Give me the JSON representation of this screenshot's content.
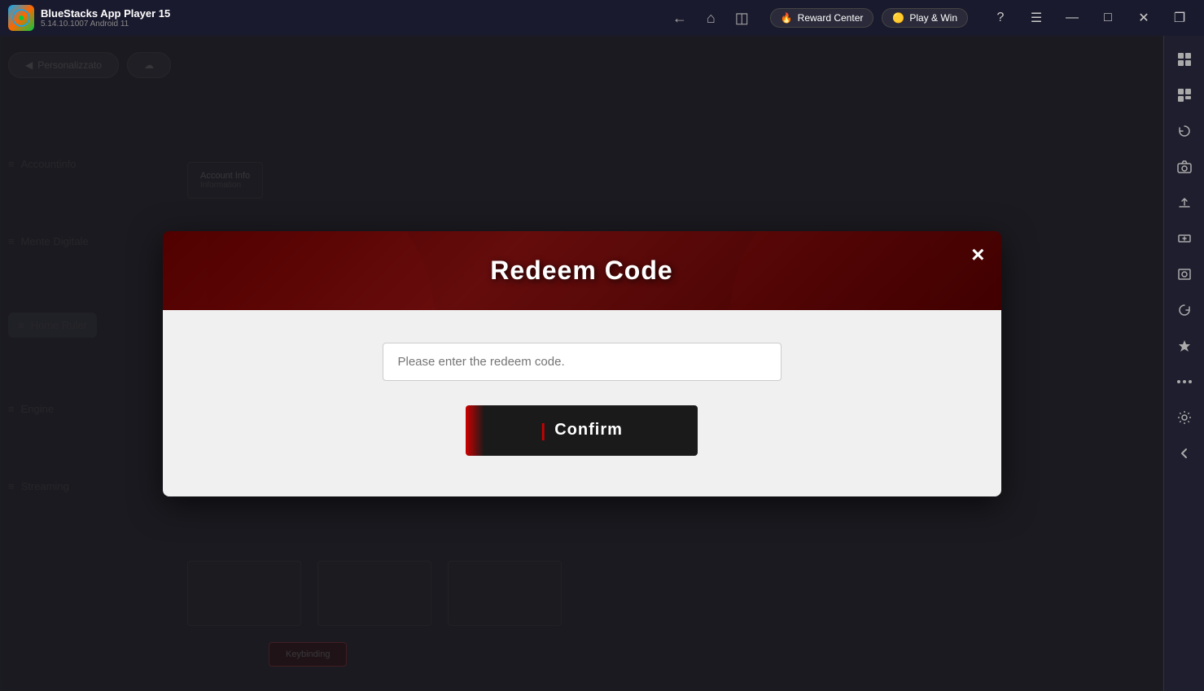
{
  "titleBar": {
    "appName": "BlueStacks App Player 15",
    "version": "5.14.10.1007  Android 11",
    "logoText": "BS",
    "nav": {
      "back": "←",
      "home": "⌂",
      "layers": "⧉"
    },
    "badges": {
      "reward": "Reward Center",
      "play": "Play & Win"
    },
    "controls": {
      "help": "?",
      "menu": "☰",
      "minimize": "—",
      "maximize": "□",
      "close": "✕",
      "snap": "❐"
    }
  },
  "rightSidebar": {
    "icons": [
      "⊞",
      "⊟",
      "↺",
      "📷",
      "⬆",
      "↕",
      "📸",
      "⟳",
      "✦",
      "•••",
      "⚙",
      "←"
    ]
  },
  "modal": {
    "title": "Redeem Code",
    "closeBtn": "×",
    "inputPlaceholder": "Please enter the redeem code.",
    "confirmBtn": "Confirm",
    "description": ""
  },
  "background": {
    "menuItems": [
      {
        "label": "Personalizzato",
        "active": false
      },
      {
        "label": "Accountinfo",
        "active": false
      },
      {
        "label": "Mente Digitale",
        "active": false
      },
      {
        "label": "Home Ruler",
        "active": true
      },
      {
        "label": "Engine",
        "active": false
      },
      {
        "label": "Streaming",
        "active": false
      }
    ]
  }
}
